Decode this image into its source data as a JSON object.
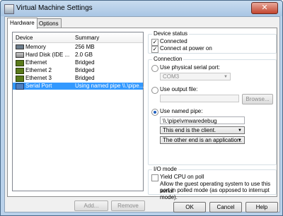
{
  "window": {
    "title": "Virtual Machine Settings",
    "close_glyph": "✕"
  },
  "tabs": [
    {
      "label": "Hardware"
    },
    {
      "label": "Options"
    }
  ],
  "device_list": {
    "headers": {
      "device": "Device",
      "summary": "Summary"
    },
    "rows": [
      {
        "device": "Memory",
        "summary": "256 MB",
        "icon": "memory-icon"
      },
      {
        "device": "Hard Disk (IDE ...",
        "summary": "2.0 GB",
        "icon": "hard-disk-icon"
      },
      {
        "device": "Ethernet",
        "summary": "Bridged",
        "icon": "ethernet-icon"
      },
      {
        "device": "Ethernet 2",
        "summary": "Bridged",
        "icon": "ethernet-icon"
      },
      {
        "device": "Ethernet 3",
        "summary": "Bridged",
        "icon": "ethernet-icon"
      },
      {
        "device": "Serial Port",
        "summary": "Using named pipe \\\\.\\pipe...",
        "icon": "serial-port-icon"
      }
    ]
  },
  "buttons": {
    "add": "Add...",
    "remove": "Remove",
    "ok": "OK",
    "cancel": "Cancel",
    "help": "Help",
    "browse": "Browse..."
  },
  "device_status": {
    "title": "Device status",
    "connected": "Connected",
    "connect_power_on": "Connect at power on"
  },
  "connection": {
    "title": "Connection",
    "physical_label": "Use physical serial port:",
    "physical_value": "COM3",
    "output_label": "Use output file:",
    "output_value": "",
    "named_pipe_label": "Use named pipe:",
    "pipe_value": "\\\\.\\pipe\\vmwaredebug",
    "end_this": "This end is the client.",
    "end_other": "The other end is an application."
  },
  "io_mode": {
    "title": "I/O mode",
    "yield_label": "Yield CPU on poll",
    "description_line1": "Allow the guest operating system to use this serial",
    "description_line2": "port in polled mode (as opposed to interrupt mode)."
  },
  "colors": {
    "selection": "#3399ff",
    "titlebar": "#b9d1ea"
  }
}
